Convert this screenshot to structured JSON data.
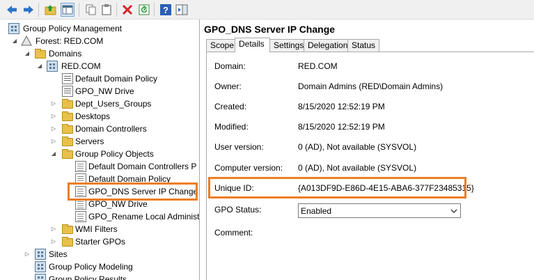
{
  "toolbar": {
    "buttons": [
      {
        "icon": "back-arrow-icon"
      },
      {
        "icon": "forward-arrow-icon"
      },
      {
        "icon": "up-folder-icon"
      },
      {
        "icon": "show-hide-console-tree-icon"
      },
      {
        "icon": "copy-icon"
      },
      {
        "icon": "paste-icon"
      },
      {
        "icon": "delete-icon"
      },
      {
        "icon": "refresh-icon"
      },
      {
        "icon": "help-icon"
      },
      {
        "icon": "show-action-pane-icon"
      }
    ]
  },
  "tree": {
    "root": "Group Policy Management",
    "forest": "Forest: RED.COM",
    "domains": "Domains",
    "domain": "RED.COM",
    "items": [
      "Default Domain Policy",
      "GPO_NW Drive",
      "Dept_Users_Groups",
      "Desktops",
      "Domain Controllers",
      "Servers",
      "Group Policy Objects"
    ],
    "gpos": [
      "Default Domain Controllers P",
      "Default Domain Policy",
      "GPO_DNS Server IP Change",
      "GPO_NW Drive",
      "GPO_Rename Local Administ"
    ],
    "wmi_filters": "WMI Filters",
    "starter_gpos": "Starter GPOs",
    "sites": "Sites",
    "modeling": "Group Policy Modeling",
    "results": "Group Policy Results"
  },
  "details": {
    "title": "GPO_DNS Server IP Change",
    "tabs": [
      "Scope",
      "Details",
      "Settings",
      "Delegation",
      "Status"
    ],
    "active_tab": "Details",
    "fields": [
      {
        "label": "Domain:",
        "value": "RED.COM"
      },
      {
        "label": "Owner:",
        "value": "Domain Admins (RED\\Domain Admins)"
      },
      {
        "label": "Created:",
        "value": "8/15/2020 12:52:19 PM"
      },
      {
        "label": "Modified:",
        "value": "8/15/2020 12:52:19 PM"
      },
      {
        "label": "User version:",
        "value": "0 (AD), Not available (SYSVOL)"
      },
      {
        "label": "Computer version:",
        "value": "0 (AD), Not available (SYSVOL)"
      },
      {
        "label": "Unique ID:",
        "value": "{A013DF9D-E86D-4E15-ABA6-377F23485315}"
      }
    ],
    "gpo_status_label": "GPO Status:",
    "gpo_status_value": "Enabled",
    "comment_label": "Comment:"
  },
  "colors": {
    "highlight": "#ec7d23"
  }
}
